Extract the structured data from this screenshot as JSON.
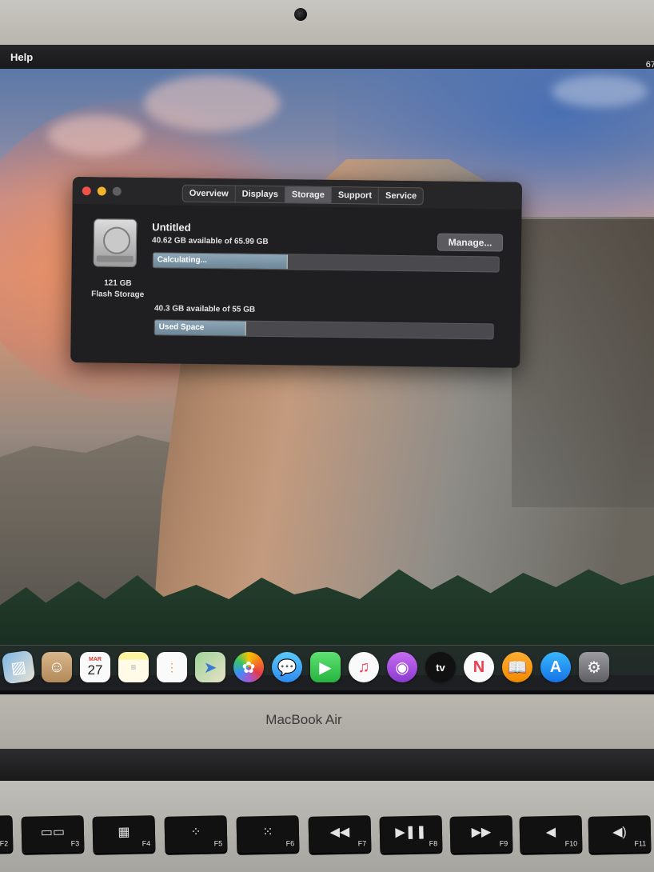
{
  "menubar": {
    "help": "Help",
    "battery": "67"
  },
  "window": {
    "tabs": [
      "Overview",
      "Displays",
      "Storage",
      "Support",
      "Service"
    ],
    "active_tab": "Storage",
    "disk": {
      "capacity": "121 GB",
      "type": "Flash Storage"
    },
    "volume1": {
      "name": "Untitled",
      "available": "40.62 GB available of 65.99 GB",
      "bar_label": "Calculating...",
      "fill_fraction": 0.39
    },
    "manage_label": "Manage...",
    "volume2": {
      "available": "40.3 GB available of 55 GB",
      "bar_label": "Used Space",
      "fill_fraction": 0.27
    }
  },
  "dock": {
    "icons": [
      "preview-icon",
      "contacts-icon",
      "calendar-icon",
      "notes-icon",
      "reminders-icon",
      "maps-icon",
      "photos-icon",
      "messages-icon",
      "facetime-icon",
      "music-icon",
      "podcasts-icon",
      "tv-icon",
      "news-icon",
      "books-icon",
      "app-store-icon",
      "system-preferences-icon"
    ],
    "calendar": {
      "month": "MAR",
      "day": "27"
    },
    "tv_label": "tv"
  },
  "laptop": {
    "brand": "MacBook Air"
  },
  "keyboard": {
    "keys": [
      {
        "glyph": "",
        "fn": "F2"
      },
      {
        "glyph": "▭▭",
        "fn": "F3"
      },
      {
        "glyph": "▦",
        "fn": "F4"
      },
      {
        "glyph": "⁘",
        "fn": "F5"
      },
      {
        "glyph": "⁙",
        "fn": "F6"
      },
      {
        "glyph": "◀◀",
        "fn": "F7"
      },
      {
        "glyph": "▶❚❚",
        "fn": "F8"
      },
      {
        "glyph": "▶▶",
        "fn": "F9"
      },
      {
        "glyph": "◀",
        "fn": "F10"
      },
      {
        "glyph": "◀)",
        "fn": "F11"
      }
    ]
  }
}
